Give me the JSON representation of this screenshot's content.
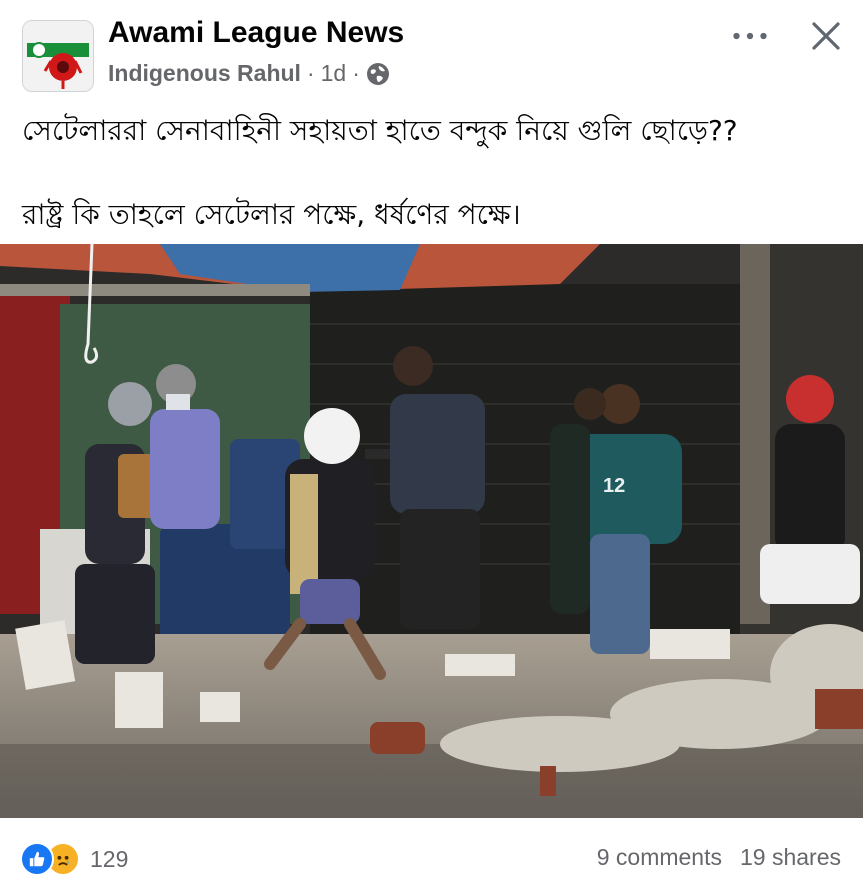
{
  "post": {
    "group_name": "Awami League News",
    "author": "Indigenous Rahul",
    "time": "1d",
    "separator": "·",
    "text_line1": "সেটেলাররা সেনাবাহিনী সহায়তা হাতে বন্দুক নিয়ে গুলি ছোড়ে??",
    "text_line2": "রাষ্ট্র কি তাহলে সেটেলার পক্ষে, ধর্ষণের পক্ষে।",
    "privacy_icon": "globe-icon"
  },
  "photo": {
    "content": "street scene with helmeted men, one aiming a gun, debris on road",
    "visible_text": "12"
  },
  "footer": {
    "reaction_count": "129",
    "comments": "9 comments",
    "shares": "19 shares",
    "like_color": "#1877f2",
    "sad_color": "#f7b125"
  },
  "colors": {
    "text": "#050505",
    "secondary": "#65676b"
  }
}
